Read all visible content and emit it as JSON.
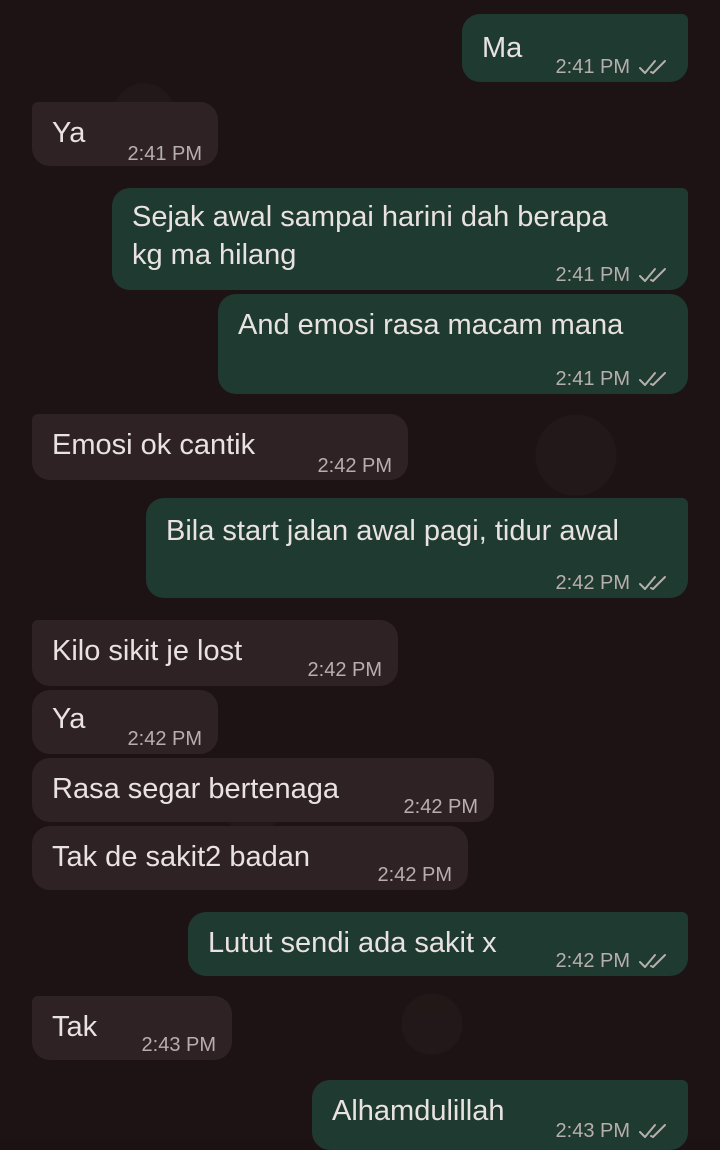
{
  "messages": [
    {
      "direction": "out",
      "text": "Ma",
      "time": "2:41 PM",
      "status": "read-double-check-icon"
    },
    {
      "direction": "in",
      "text": "Ya",
      "time": "2:41 PM"
    },
    {
      "direction": "out",
      "text": "Sejak awal sampai harini dah berapa\nkg ma hilang",
      "time": "2:41 PM",
      "status": "read-double-check-icon"
    },
    {
      "direction": "out",
      "text": "And emosi rasa macam mana",
      "time": "2:41 PM",
      "status": "read-double-check-icon"
    },
    {
      "direction": "in",
      "text": "Emosi ok cantik",
      "time": "2:42 PM"
    },
    {
      "direction": "out",
      "text": "Bila start jalan awal pagi, tidur awal",
      "time": "2:42 PM",
      "status": "read-double-check-icon"
    },
    {
      "direction": "in",
      "text": "Kilo sikit je lost",
      "time": "2:42 PM"
    },
    {
      "direction": "in",
      "text": "Ya",
      "time": "2:42 PM"
    },
    {
      "direction": "in",
      "text": "Rasa segar bertenaga",
      "time": "2:42 PM"
    },
    {
      "direction": "in",
      "text": "Tak de sakit2 badan",
      "time": "2:42 PM"
    },
    {
      "direction": "out",
      "text": "Lutut sendi ada sakit x",
      "time": "2:42 PM",
      "status": "read-double-check-icon"
    },
    {
      "direction": "in",
      "text": "Tak",
      "time": "2:43 PM"
    },
    {
      "direction": "out",
      "text": "Alhamdulillah",
      "time": "2:43 PM",
      "status": "read-double-check-icon"
    }
  ],
  "colors": {
    "background": "#1e1314",
    "incoming_bubble": "#2f2224",
    "outgoing_bubble": "#1f3a30",
    "text": "#e9e2e2",
    "meta": "#b7afae"
  }
}
